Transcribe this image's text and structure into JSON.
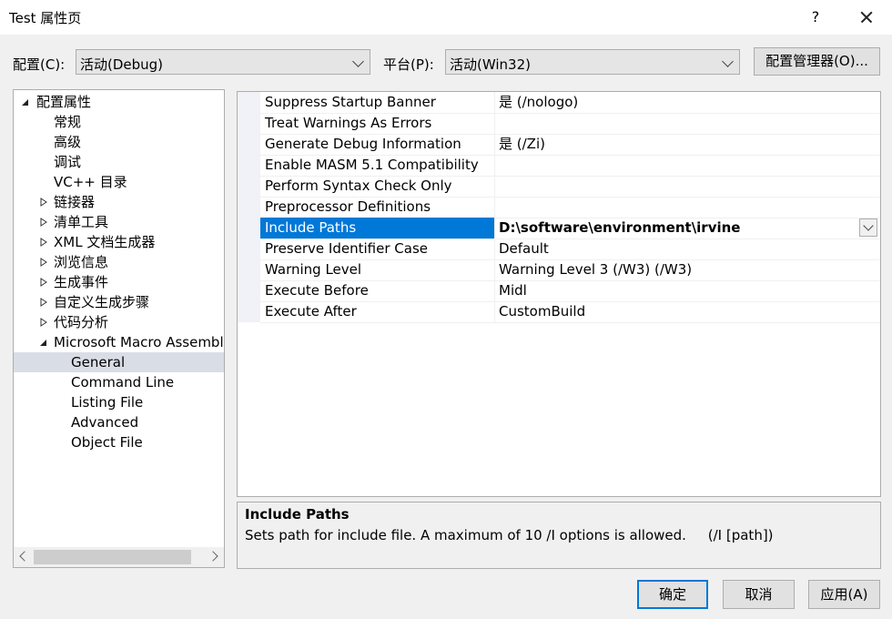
{
  "window": {
    "title": "Test 属性页",
    "help": "?",
    "close": "close-icon"
  },
  "config": {
    "label": "配置(C):",
    "value": "活动(Debug)"
  },
  "platform": {
    "label": "平台(P):",
    "value": "活动(Win32)"
  },
  "config_manager_label": "配置管理器(O)...",
  "tree": {
    "root": "配置属性",
    "items": [
      "常规",
      "高级",
      "调试",
      "VC++ 目录",
      "链接器",
      "清单工具",
      "XML 文档生成器",
      "浏览信息",
      "生成事件",
      "自定义生成步骤",
      "代码分析",
      "Microsoft Macro Assembler"
    ],
    "children": [
      "General",
      "Command Line",
      "Listing File",
      "Advanced",
      "Object File"
    ]
  },
  "properties": [
    {
      "name": "Suppress Startup Banner",
      "value": "是 (/nologo)"
    },
    {
      "name": "Treat Warnings As Errors",
      "value": ""
    },
    {
      "name": "Generate Debug Information",
      "value": "是 (/Zi)"
    },
    {
      "name": "Enable MASM 5.1 Compatibility",
      "value": ""
    },
    {
      "name": "Perform Syntax Check Only",
      "value": ""
    },
    {
      "name": "Preprocessor Definitions",
      "value": ""
    },
    {
      "name": "Include Paths",
      "value": "D:\\software\\environment\\irvine"
    },
    {
      "name": "Preserve Identifier Case",
      "value": "Default"
    },
    {
      "name": "Warning Level",
      "value": "Warning Level 3 (/W3) (/W3)"
    },
    {
      "name": "Execute Before",
      "value": "Midl"
    },
    {
      "name": "Execute After",
      "value": "CustomBuild"
    }
  ],
  "description": {
    "title": "Include Paths",
    "text": "Sets path for include file. A maximum of 10 /I options is allowed.     (/I [path])"
  },
  "buttons": {
    "ok": "确定",
    "cancel": "取消",
    "apply": "应用(A)"
  }
}
